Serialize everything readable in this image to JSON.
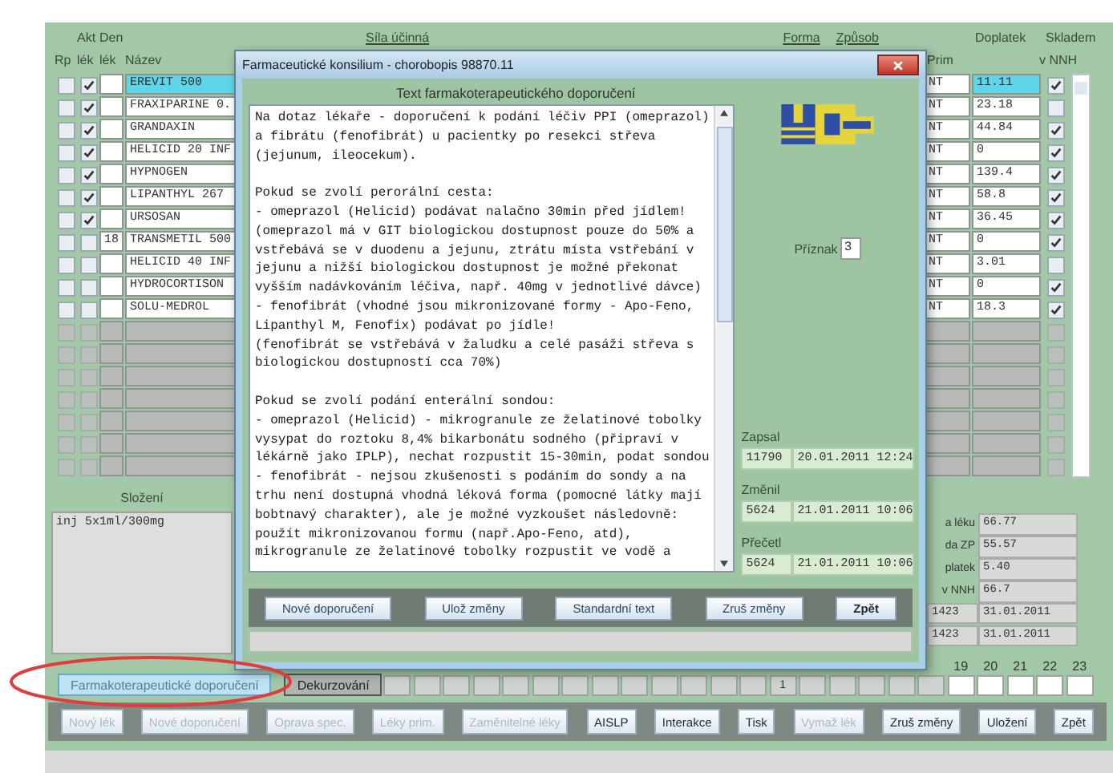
{
  "main_window": {
    "header": {
      "akt": "Akt",
      "den": "Den",
      "sila": "Síla účinná",
      "forma": "Forma",
      "zpusob": "Způsob",
      "doplatek": "Doplatek",
      "skladem": "Skladem",
      "rp": "Rp",
      "lek": "lék",
      "den_lek": "lék",
      "nazev": "Název",
      "prim": "Prim",
      "v_nnh": "v NNH"
    },
    "rows": [
      {
        "kind": "drug",
        "selected": true,
        "rp": false,
        "lek": true,
        "name": "EREVIT 500",
        "forma": "NT",
        "doplatek": "11.11",
        "skladem": true
      },
      {
        "kind": "drug",
        "selected": false,
        "rp": false,
        "lek": true,
        "name": "FRAXIPARINE 0.",
        "forma": "NT",
        "doplatek": "23.18",
        "skladem": false
      },
      {
        "kind": "drug",
        "selected": false,
        "rp": false,
        "lek": true,
        "name": "GRANDAXIN",
        "forma": "NT",
        "doplatek": "44.84",
        "skladem": true
      },
      {
        "kind": "drug",
        "selected": false,
        "rp": false,
        "lek": true,
        "name": "HELICID 20 INF",
        "forma": "NT",
        "doplatek": "0",
        "skladem": true
      },
      {
        "kind": "drug",
        "selected": false,
        "rp": false,
        "lek": true,
        "name": "HYPNOGEN",
        "forma": "NT",
        "doplatek": "139.4",
        "skladem": true
      },
      {
        "kind": "drug",
        "selected": false,
        "rp": false,
        "lek": true,
        "name": "LIPANTHYL 267",
        "forma": "NT",
        "doplatek": "58.8",
        "skladem": true
      },
      {
        "kind": "drug",
        "selected": false,
        "rp": false,
        "lek": true,
        "name": "URSOSAN",
        "forma": "NT",
        "doplatek": "36.45",
        "skladem": true
      },
      {
        "kind": "drug",
        "selected": false,
        "rp": false,
        "lek": false,
        "den": "18",
        "name": "TRANSMETIL 500",
        "forma": "NT",
        "doplatek": "0",
        "skladem": true
      },
      {
        "kind": "drug",
        "selected": false,
        "rp": false,
        "lek": false,
        "name": "HELICID 40 INF",
        "forma": "NT",
        "doplatek": "3.01",
        "skladem": false
      },
      {
        "kind": "drug",
        "selected": false,
        "rp": false,
        "lek": false,
        "name": "HYDROCORTISON",
        "forma": "NT",
        "doplatek": "0",
        "skladem": true
      },
      {
        "kind": "drug",
        "selected": false,
        "rp": false,
        "lek": false,
        "name": "SOLU-MEDROL",
        "forma": "NT",
        "doplatek": "18.3",
        "skladem": true
      },
      {
        "kind": "empty",
        "rp": false,
        "lek": false,
        "skladem": false
      },
      {
        "kind": "empty",
        "rp": false,
        "lek": false,
        "skladem": false
      },
      {
        "kind": "empty",
        "rp": false,
        "lek": false,
        "skladem": false
      },
      {
        "kind": "empty",
        "rp": false,
        "lek": false,
        "skladem": false
      },
      {
        "kind": "empty",
        "rp": false,
        "lek": false,
        "skladem": false
      },
      {
        "kind": "empty",
        "rp": false,
        "lek": false,
        "skladem": false
      },
      {
        "kind": "empty",
        "rp": false,
        "lek": false,
        "skladem": false
      }
    ],
    "composition": {
      "label": "Složení",
      "value": "inj 5x1ml/300mg"
    },
    "summary": [
      {
        "label": "a léku",
        "value": "66.77"
      },
      {
        "label": "da ZP",
        "value": "55.57"
      },
      {
        "label": "platek",
        "value": "5.40"
      },
      {
        "label": "v NNH",
        "value": "66.7"
      }
    ],
    "validity": [
      {
        "code": "1423",
        "date": "31.01.2011"
      },
      {
        "code": "1423",
        "date": "31.01.2011"
      }
    ],
    "tabs": [
      {
        "label": "Farmakoterapeutické doporučení",
        "selected": true
      },
      {
        "label": "Dekurzování",
        "selected": false
      }
    ],
    "hour_boxes": [
      {
        "enabled": false
      },
      {
        "enabled": false
      },
      {
        "enabled": false
      },
      {
        "enabled": false
      },
      {
        "enabled": false
      },
      {
        "enabled": false
      },
      {
        "enabled": false
      },
      {
        "enabled": false
      },
      {
        "enabled": false
      },
      {
        "enabled": false
      },
      {
        "enabled": false
      },
      {
        "enabled": false
      },
      {
        "enabled": false
      },
      {
        "enabled": false,
        "text": "1"
      },
      {
        "enabled": false
      },
      {
        "enabled": false
      },
      {
        "enabled": false
      },
      {
        "enabled": false
      },
      {
        "enabled": false
      },
      {
        "enabled": true,
        "label": "19"
      },
      {
        "enabled": true,
        "label": "20"
      },
      {
        "enabled": true,
        "label": "21"
      },
      {
        "enabled": true,
        "label": "22"
      },
      {
        "enabled": true,
        "label": "23"
      }
    ],
    "buttons": [
      {
        "label": "Nový lék",
        "disabled": true
      },
      {
        "label": "Nové doporučení",
        "disabled": true
      },
      {
        "label": "Oprava spec.",
        "disabled": true
      },
      {
        "label": "Léky prim.",
        "disabled": true
      },
      {
        "label": "Zaměnitelné léky",
        "disabled": true
      },
      {
        "label": "AISLP",
        "disabled": false
      },
      {
        "label": "Interakce",
        "disabled": false
      },
      {
        "label": "Tisk",
        "disabled": false
      },
      {
        "label": "Vymaž lék",
        "disabled": true
      },
      {
        "label": "Zruš změny",
        "disabled": false
      },
      {
        "label": "Uložení",
        "disabled": false
      },
      {
        "label": "Zpět",
        "disabled": false
      }
    ]
  },
  "dialog": {
    "title": "Farmaceutické konsilium - chorobopis 98870.11",
    "heading": "Text farmakoterapeutického doporučení",
    "text": "Na dotaz lékaře - doporučení k podání léčiv PPI (omeprazol)\na fibrátu (fenofibrát) u pacientky po resekci střeva\n(jejunum, ileocekum).\n\nPokud se zvolí perorální cesta:\n- omeprazol (Helicid) podávat nalačno 30min před jídlem!\n(omeprazol má v GIT biologickou dostupnost pouze do 50% a\nvstřebává se v duodenu a jejunu, ztrátu místa vstřebání v\njejunu a nižší biologickou dostupnost je možné překonat\nvyšším nadávkováním léčiva, např. 40mg v jednotlivé dávce)\n- fenofibrát (vhodné jsou mikronizované formy - Apo-Feno,\nLipanthyl M, Fenofix) podávat po jídle!\n(fenofibrát se vstřebává v žaludku a celé pasáži střeva s\nbiologickou dostupností cca 70%)\n\nPokud se zvolí podání enterální sondou:\n- omeprazol (Helicid) - mikrogranule ze želatinové tobolky\nvysypat do roztoku 8,4% bikarbonátu sodného (připraví v\nlékárně jako IPLP), nechat rozpustit 15-30min, podat sondou\n- fenofibrát - nejsou zkušenosti s podáním do sondy a na\ntrhu není dostupná vhodná léková forma (pomocné látky mají\nbobtnavý charakter), ale je možné vyzkoušet následovně:\npoužít mikronizovanou formu (např.Apo-Feno, atd),\nmikrogranule ze želatinové tobolky rozpustit ve vodě a",
    "priznak": {
      "label": "Příznak",
      "value": "3"
    },
    "records": [
      {
        "label": "Zapsal",
        "code": "11790",
        "date": "20.01.2011 12:24"
      },
      {
        "label": "Změnil",
        "code": "5624",
        "date": "21.01.2011 10:06"
      },
      {
        "label": "Přečetl",
        "code": "5624",
        "date": "21.01.2011 10:06"
      }
    ],
    "buttons": [
      {
        "label": "Nové doporučení",
        "bold": false
      },
      {
        "label": "Ulož změny",
        "bold": false
      },
      {
        "label": "Standardní text",
        "bold": false
      },
      {
        "label": "Zruš změny",
        "bold": false
      },
      {
        "label": "Zpět",
        "bold": true
      }
    ]
  }
}
